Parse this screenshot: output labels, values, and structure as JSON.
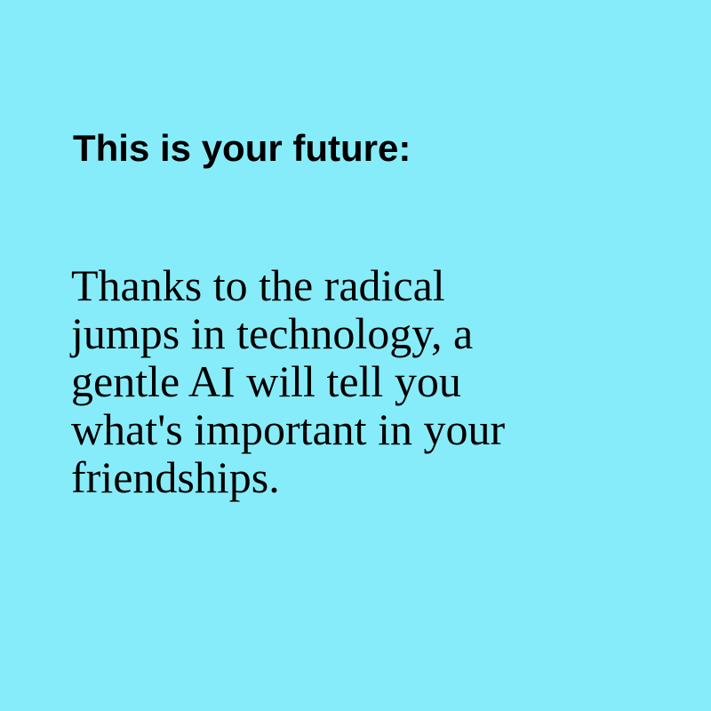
{
  "colors": {
    "background": "#87ecf9",
    "text": "#000000"
  },
  "heading": "This is your future:",
  "body_lines": [
    "Thanks to the radical",
    "jumps in technology, a",
    "gentle AI will tell you",
    "what's important in your",
    "friendships."
  ]
}
